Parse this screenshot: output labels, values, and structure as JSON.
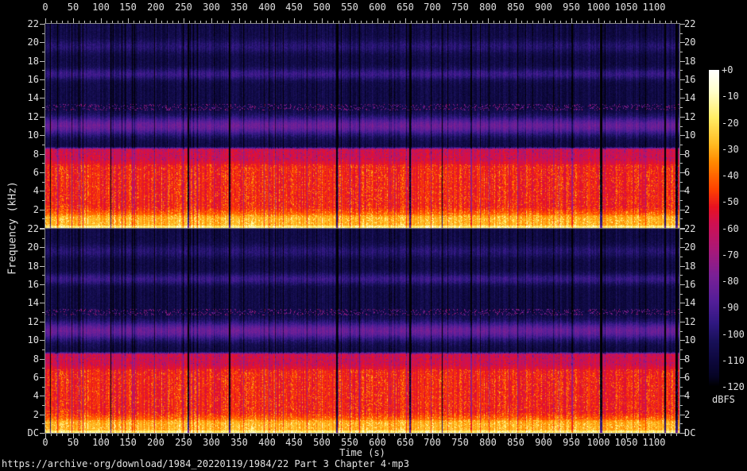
{
  "figure": {
    "background": "#000000",
    "footer_url": "https://archive·org/download/1984_20220119/1984/22 Part 3 Chapter 4·mp3",
    "text_color": "#e2e2e2",
    "frame_color": "#8a8a8a",
    "tick_color": "#c0c0c0"
  },
  "chart_data": {
    "type": "heatmap",
    "subtype": "audio-spectrogram",
    "description": "Two stacked stereo-channel spectrograms of an MP3 audiobook chapter. Bright red/orange/yellow speech energy fills DC to ~8.7 kHz (lowpass cutoff), dark navy above, with purple resonance bands near 10-12 kHz and 16-17 kHz, a speckled dotted line near 13 kHz, a faint band near 19-20 kHz, and vertical dark silence gaps.",
    "channels": 2,
    "xlabel": "Time (s)",
    "ylabel": "Frequency (kHz)",
    "x_range_s": [
      0,
      1146
    ],
    "x_major_step_s": 50,
    "x_minor_step_s": 10,
    "x_tick_labels": [
      "0",
      "50",
      "100",
      "150",
      "200",
      "250",
      "300",
      "350",
      "400",
      "450",
      "500",
      "550",
      "600",
      "650",
      "700",
      "750",
      "800",
      "850",
      "900",
      "950",
      "1000",
      "1050",
      "1100"
    ],
    "y_range_khz": [
      0,
      22
    ],
    "y_major_step_khz": 2,
    "y_minor_step_khz": 1,
    "y_tick_labels": [
      "22",
      "20",
      "18",
      "16",
      "14",
      "12",
      "10",
      "8",
      "6",
      "4",
      "2"
    ],
    "dc_label": "DC",
    "colorbar": {
      "title": "dBFS",
      "range_db": [
        0,
        -120
      ],
      "step_db": 10,
      "tick_labels": [
        "+0",
        "-10",
        "-20",
        "-30",
        "-40",
        "-50",
        "-60",
        "-70",
        "-80",
        "-90",
        "-100",
        "-110",
        "-120"
      ]
    },
    "palette_stops": [
      [
        -120,
        "#000000"
      ],
      [
        -116,
        "#060426"
      ],
      [
        -110,
        "#0d083e"
      ],
      [
        -103,
        "#181058"
      ],
      [
        -96,
        "#301882"
      ],
      [
        -88,
        "#521e98"
      ],
      [
        -78,
        "#7a2096"
      ],
      [
        -68,
        "#aa1878"
      ],
      [
        -58,
        "#d01050"
      ],
      [
        -52,
        "#e81222"
      ],
      [
        -45,
        "#ff4400"
      ],
      [
        -35,
        "#ff8800"
      ],
      [
        -28,
        "#ffbb22"
      ],
      [
        -18,
        "#ffee66"
      ],
      [
        -8,
        "#ffffcc"
      ],
      [
        0,
        "#ffffff"
      ]
    ],
    "level_profile": {
      "dc_line": {
        "f_max_khz": 0.18,
        "level_db": -22
      },
      "red_zone": {
        "f_max_khz": 8.7,
        "segments": [
          [
            0.18,
            -34
          ],
          [
            1.0,
            -34
          ],
          [
            2.2,
            -50
          ],
          [
            6.5,
            -50
          ],
          [
            7.4,
            -56
          ],
          [
            8.45,
            -56
          ],
          [
            8.7,
            -100
          ]
        ]
      },
      "navy_base_db": -107,
      "navy_bumps": [
        {
          "center_khz": 11.0,
          "width_khz": 1.0,
          "amp_db": 26
        },
        {
          "center_khz": 16.6,
          "width_khz": 0.6,
          "amp_db": 14
        },
        {
          "center_khz": 19.6,
          "width_khz": 0.7,
          "amp_db": 9
        }
      ],
      "speckle_line": {
        "f_min_khz": 12.7,
        "f_max_khz": 13.35,
        "prob": 0.16,
        "level_db": -80,
        "jitter_db": 14
      }
    },
    "texture": {
      "seed_cols": 1234,
      "seed_pixels": 99,
      "col_mod_range_db": [
        -6,
        4
      ],
      "dark_line_prob": 0.07,
      "dark_line_extra_db": [
        10,
        24
      ],
      "pixel_noise_db": 7,
      "flame_prob_scale": 0.55,
      "flame_boost_db": [
        7,
        13
      ],
      "flame_f_max_khz": 6.8,
      "bass_boost_db": 5,
      "bass_f_max_khz": 1.3,
      "purple_streak_prob": 0.3,
      "purple_streak_db": [
        9,
        13
      ],
      "purple_f_min_khz": 7.2,
      "gap_mod_db": -70
    },
    "gaps_s": [
      [
        9,
        1.5
      ],
      [
        119,
        1.5
      ],
      [
        258,
        2.5
      ],
      [
        333,
        2.5
      ],
      [
        527,
        2.5
      ],
      [
        659,
        2.5
      ],
      [
        718,
        1.5
      ],
      [
        1005,
        4
      ],
      [
        1120,
        3
      ],
      [
        1141,
        4
      ]
    ]
  }
}
